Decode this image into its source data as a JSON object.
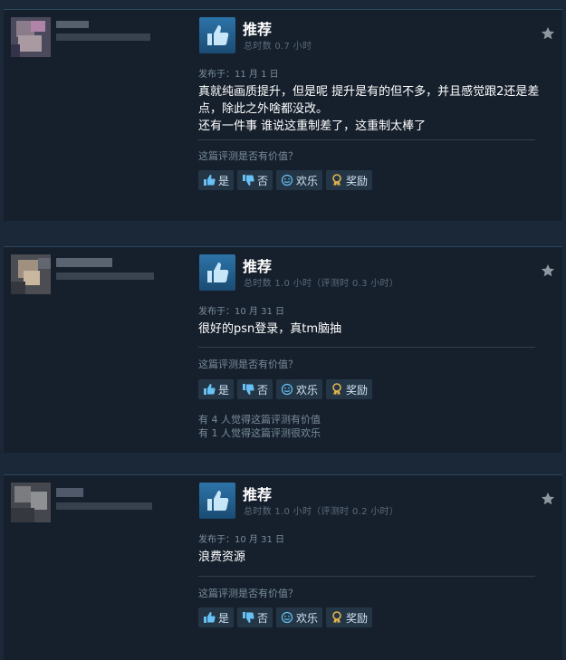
{
  "reviews": [
    {
      "verdict": "推荐",
      "hours": "总时数 0.7 小时",
      "posted": "发布于：11 月 1 日",
      "body_lines": [
        "真就纯画质提升，但是呢 提升是有的但不多，并且感觉跟2还是差",
        "点，除此之外啥都没改。",
        "还有一件事 谁说这重制差了，这重制太棒了"
      ],
      "question": "这篇评测是否有价值？",
      "buttons": {
        "yes": "是",
        "no": "否",
        "funny": "欢乐",
        "award": "奖励"
      },
      "votes": []
    },
    {
      "verdict": "推荐",
      "hours": "总时数 1.0 小时（评测时 0.3 小时）",
      "posted": "发布于：10 月 31 日",
      "body_lines": [
        "很好的psn登录，真tm脑抽"
      ],
      "question": "这篇评测是否有价值？",
      "buttons": {
        "yes": "是",
        "no": "否",
        "funny": "欢乐",
        "award": "奖励"
      },
      "votes": [
        "有 4 人觉得这篇评测有价值",
        "有 1 人觉得这篇评测很欢乐"
      ]
    },
    {
      "verdict": "推荐",
      "hours": "总时数 1.0 小时（评测时 0.2 小时）",
      "posted": "发布于：10 月 31 日",
      "body_lines": [
        "浪费资源"
      ],
      "question": "这篇评测是否有价值？",
      "buttons": {
        "yes": "是",
        "no": "否",
        "funny": "欢乐",
        "award": "奖励"
      },
      "votes": []
    }
  ],
  "colors": {
    "background": "#1b2838",
    "panel": "#16202d",
    "accent": "#67c1f5",
    "thumb": "#2d73a8"
  },
  "icons": {
    "verdict": "thumbs-up-icon",
    "favorite": "star-icon",
    "yes": "thumbs-up-icon",
    "no": "thumbs-down-icon",
    "funny": "smiley-icon",
    "award": "award-ribbon-icon"
  }
}
